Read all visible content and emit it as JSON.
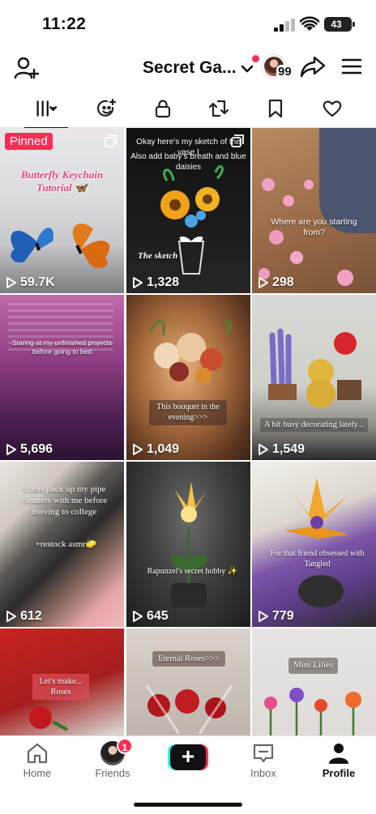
{
  "status": {
    "time": "11:22",
    "battery": "43"
  },
  "header": {
    "title": "Secret Ga...",
    "story_count": "99"
  },
  "tabs": [
    {
      "icon": "grid-icon",
      "active": true
    },
    {
      "icon": "sparkle-face-icon"
    },
    {
      "icon": "lock-icon"
    },
    {
      "icon": "repost-icon"
    },
    {
      "icon": "bookmark-icon"
    },
    {
      "icon": "heart-icon"
    }
  ],
  "videos": [
    {
      "views": "59.7K",
      "pinned_label": "Pinned",
      "caption": "Butterfly Keychain Tutorial 🦋"
    },
    {
      "views": "1,328",
      "caption_top": "Okay here's my sketch of the vase I",
      "caption_sub": "Also add baby's breath and blue daisies",
      "caption": "The sketch"
    },
    {
      "views": "298",
      "caption": "Where are you starting from?"
    },
    {
      "views": "5,696",
      "caption": "Staring at my unfinished projects before going to bed"
    },
    {
      "views": "1,049",
      "caption": "This bouquet in the evening>>>"
    },
    {
      "views": "1,549",
      "caption": "A bit busy decorating lately..."
    },
    {
      "views": "612",
      "caption": "Come pack up my pipe cleaners with me before moving to college",
      "caption_sub": "+restock asmr🧽"
    },
    {
      "views": "645",
      "caption": "Rapunzel's secret hobby ✨"
    },
    {
      "views": "779",
      "caption": "For that friend obsessed with Tangled"
    },
    {
      "caption": "Let's make... Roses"
    },
    {
      "caption": "Eternal Roses>>>"
    },
    {
      "caption": "Mini Lilies"
    }
  ],
  "nav": {
    "home": "Home",
    "friends": "Friends",
    "friends_badge": "1",
    "create": "+",
    "inbox": "Inbox",
    "profile": "Profile"
  },
  "colors": {
    "accent": "#fe2c55",
    "cyan": "#25f4ee"
  }
}
